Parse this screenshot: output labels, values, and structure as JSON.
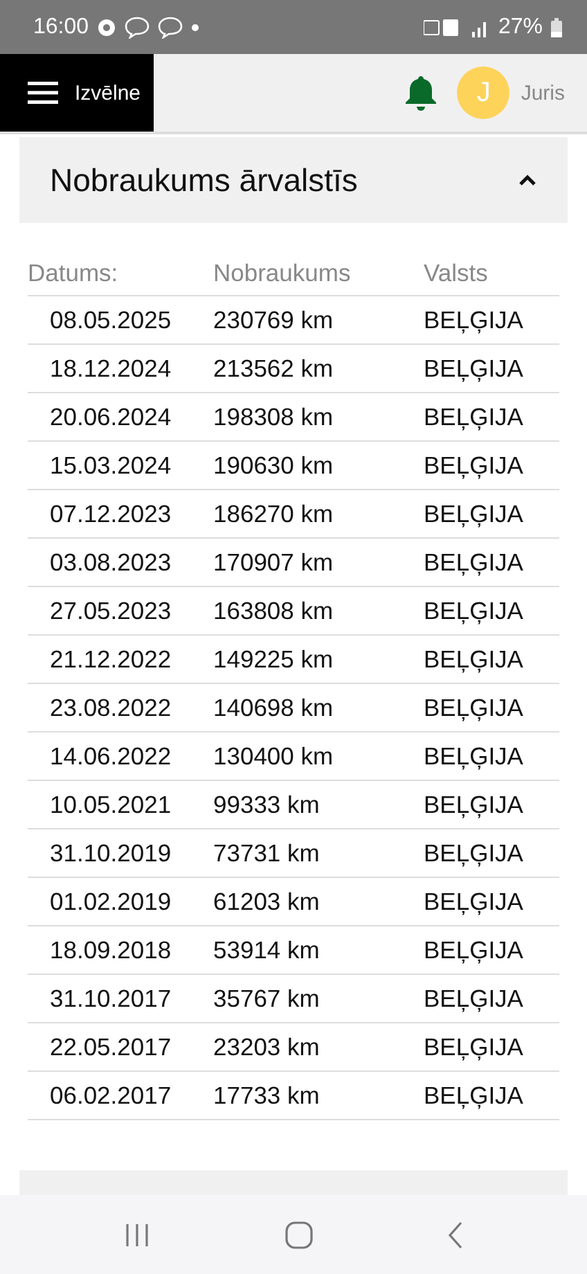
{
  "status_bar": {
    "time": "16:00",
    "battery": "27%"
  },
  "header": {
    "menu_label": "Izvēlne",
    "avatar_initial": "J",
    "user_name": "Juris"
  },
  "section": {
    "title": "Nobraukums ārvalstīs",
    "expanded": true
  },
  "table": {
    "columns": [
      "Datums:",
      "Nobraukums",
      "Valsts"
    ],
    "rows": [
      [
        "08.05.2025",
        "230769 km",
        "BEĻĢIJA"
      ],
      [
        "18.12.2024",
        "213562 km",
        "BEĻĢIJA"
      ],
      [
        "20.06.2024",
        "198308 km",
        "BEĻĢIJA"
      ],
      [
        "15.03.2024",
        "190630 km",
        "BEĻĢIJA"
      ],
      [
        "07.12.2023",
        "186270 km",
        "BEĻĢIJA"
      ],
      [
        "03.08.2023",
        "170907 km",
        "BEĻĢIJA"
      ],
      [
        "27.05.2023",
        "163808 km",
        "BEĻĢIJA"
      ],
      [
        "21.12.2022",
        "149225 km",
        "BEĻĢIJA"
      ],
      [
        "23.08.2022",
        "140698 km",
        "BEĻĢIJA"
      ],
      [
        "14.06.2022",
        "130400 km",
        "BEĻĢIJA"
      ],
      [
        "10.05.2021",
        "99333 km",
        "BEĻĢIJA"
      ],
      [
        "31.10.2019",
        "73731 km",
        "BEĻĢIJA"
      ],
      [
        "01.02.2019",
        "61203 km",
        "BEĻĢIJA"
      ],
      [
        "18.09.2018",
        "53914 km",
        "BEĻĢIJA"
      ],
      [
        "31.10.2017",
        "35767 km",
        "BEĻĢIJA"
      ],
      [
        "22.05.2017",
        "23203 km",
        "BEĻĢIJA"
      ],
      [
        "06.02.2017",
        "17733 km",
        "BEĻĢIJA"
      ]
    ]
  }
}
